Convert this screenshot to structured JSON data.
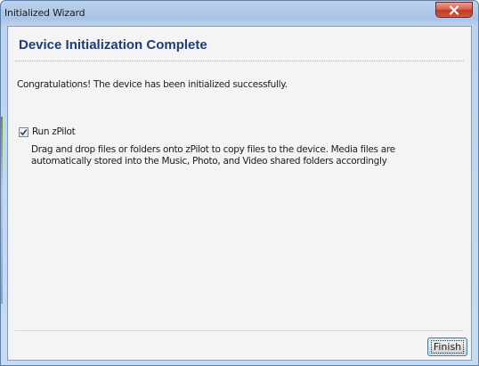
{
  "window": {
    "title": "Initialized Wizard",
    "close_icon": "close-x-icon"
  },
  "page": {
    "title": "Device Initialization Complete",
    "message": "Congratulations! The device has been initialized successfully."
  },
  "option": {
    "checkbox_label": "Run zPilot",
    "checked": true,
    "description": "Drag and drop files or folders onto zPilot to copy files to the device. Media files are automatically stored into the Music, Photo, and Video shared folders accordingly"
  },
  "footer": {
    "finish_label": "Finish"
  },
  "colors": {
    "title_color": "#1f3d77",
    "close_button": "#c23a24",
    "focus_border": "#3c7fb1"
  }
}
